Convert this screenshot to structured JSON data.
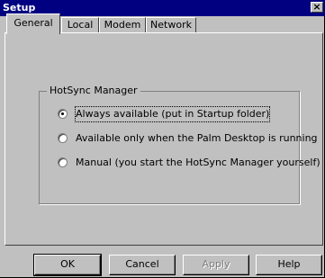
{
  "window": {
    "title": "Setup",
    "close_glyph": "×"
  },
  "tabs": [
    {
      "label": "General",
      "active": true
    },
    {
      "label": "Local",
      "active": false
    },
    {
      "label": "Modem",
      "active": false
    },
    {
      "label": "Network",
      "active": false
    }
  ],
  "group": {
    "label": "HotSync Manager",
    "options": [
      {
        "label": "Always available (put in Startup folder)",
        "selected": true
      },
      {
        "label": "Available only when the Palm Desktop is running",
        "selected": false
      },
      {
        "label": "Manual (you start the HotSync Manager yourself)",
        "selected": false
      }
    ]
  },
  "buttons": {
    "ok": "OK",
    "cancel": "Cancel",
    "apply": "Apply",
    "help": "Help"
  }
}
